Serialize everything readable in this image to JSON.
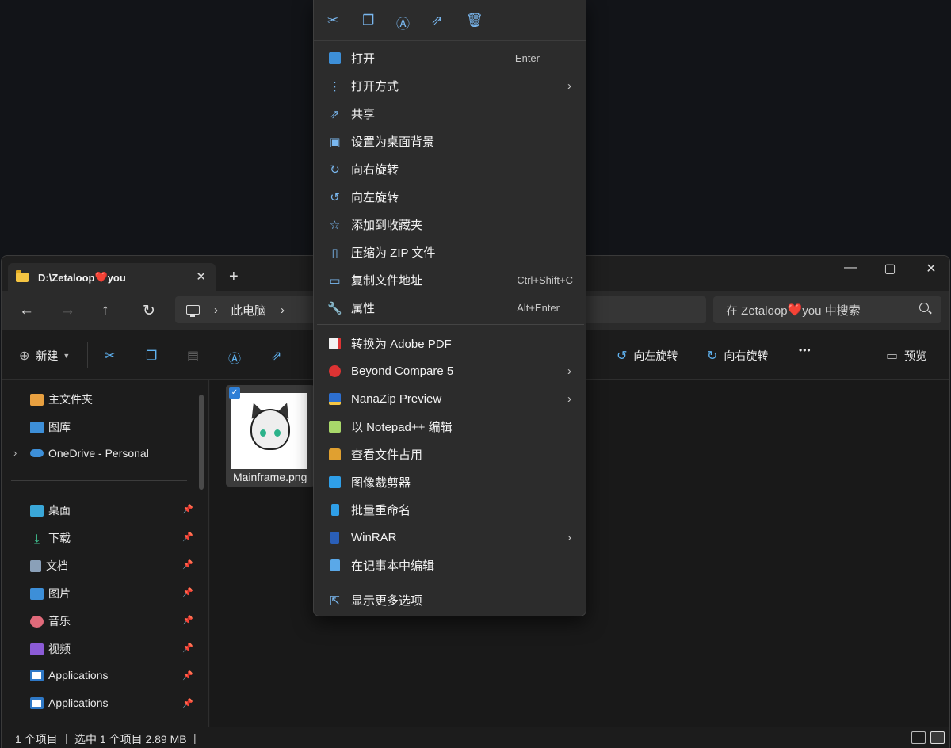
{
  "window": {
    "tab_title_prefix": "D:\\Zetaloop",
    "tab_title_heart": "❤️",
    "tab_title_suffix": " you",
    "tab_close": "✕",
    "new_tab": "+",
    "minimize": "—",
    "maximize": "▢",
    "close": "✕"
  },
  "navigation": {
    "back": "←",
    "forward": "→",
    "up": "↑",
    "refresh": "↻",
    "breadcrumb_root": "此电脑",
    "chevron": "›",
    "search_placeholder_prefix": "在 Zetaloop",
    "search_placeholder_heart": "❤️",
    "search_placeholder_suffix": "you 中搜索"
  },
  "commandbar": {
    "new_label": "新建",
    "rotate_left": "向左旋转",
    "rotate_right": "向右旋转",
    "more": "•••",
    "preview": "预览"
  },
  "sidebar": {
    "items": [
      {
        "label": "主文件夹",
        "icon": "home-icon"
      },
      {
        "label": "图库",
        "icon": "gallery-icon"
      },
      {
        "label": "OneDrive - Personal",
        "icon": "cloud-icon"
      },
      {
        "label": "桌面",
        "icon": "desktop-icon"
      },
      {
        "label": "下载",
        "icon": "download-icon"
      },
      {
        "label": "文档",
        "icon": "document-icon"
      },
      {
        "label": "图片",
        "icon": "pictures-icon"
      },
      {
        "label": "音乐",
        "icon": "music-icon"
      },
      {
        "label": "视频",
        "icon": "video-icon"
      },
      {
        "label": "Applications",
        "icon": "app-icon"
      },
      {
        "label": "Applications",
        "icon": "app-icon"
      }
    ]
  },
  "content": {
    "file_name": "Mainframe.png",
    "checkmark": "✓"
  },
  "status": {
    "items_count": "1 个项目",
    "selected": "选中 1 个项目  2.89 MB"
  },
  "context_menu": {
    "top_icons": [
      "cut-icon",
      "copy-icon",
      "rename-icon",
      "share-icon",
      "delete-icon"
    ],
    "items": [
      {
        "label": "打开",
        "shortcut": "Enter"
      },
      {
        "label": "打开方式",
        "submenu": "›"
      },
      {
        "label": "共享"
      },
      {
        "label": "设置为桌面背景"
      },
      {
        "label": "向右旋转"
      },
      {
        "label": "向左旋转"
      },
      {
        "label": "添加到收藏夹"
      },
      {
        "label": "压缩为 ZIP 文件"
      },
      {
        "label": "复制文件地址",
        "shortcut": "Ctrl+Shift+C"
      },
      {
        "label": "属性",
        "shortcut": "Alt+Enter"
      },
      {
        "label": "转换为 Adobe PDF"
      },
      {
        "label": "Beyond Compare 5",
        "submenu": "›"
      },
      {
        "label": "NanaZip Preview",
        "submenu": "›"
      },
      {
        "label": "以 Notepad++ 编辑"
      },
      {
        "label": "查看文件占用"
      },
      {
        "label": "图像裁剪器"
      },
      {
        "label": "批量重命名"
      },
      {
        "label": "WinRAR",
        "submenu": "›"
      },
      {
        "label": "在记事本中编辑"
      },
      {
        "label": "显示更多选项"
      }
    ]
  },
  "colors": {
    "accent": "#5fb2f0",
    "heart": "#e03b3b",
    "menu_bg": "#2c2c2c",
    "window_bg": "#1c1c1c"
  }
}
